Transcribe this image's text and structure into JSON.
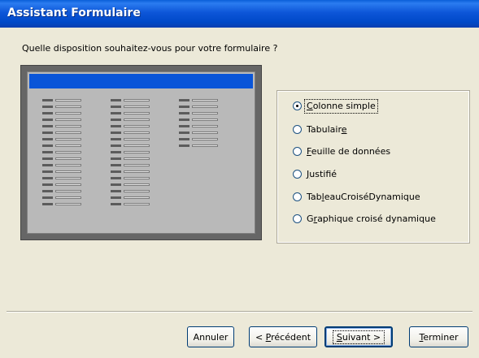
{
  "window": {
    "title": "Assistant Formulaire"
  },
  "question": "Quelle disposition souhaitez-vous pour votre formulaire ?",
  "options": [
    {
      "pre": "",
      "mn": "C",
      "post": "olonne simple",
      "checked": true
    },
    {
      "pre": "Tabulair",
      "mn": "e",
      "post": "",
      "checked": false
    },
    {
      "pre": "",
      "mn": "F",
      "post": "euille de données",
      "checked": false
    },
    {
      "pre": "",
      "mn": "J",
      "post": "ustifié",
      "checked": false
    },
    {
      "pre": "Tab",
      "mn": "l",
      "post": "eauCroiséDynamique",
      "checked": false
    },
    {
      "pre": "G",
      "mn": "r",
      "post": "aphique croisé dynamique",
      "checked": false
    }
  ],
  "buttons": {
    "cancel": "Annuler",
    "back_pre": "< ",
    "back_mn": "P",
    "back_post": "récédent",
    "next_mn": "S",
    "next_post": "uivant >",
    "finish_mn": "T",
    "finish_post": "erminer"
  }
}
